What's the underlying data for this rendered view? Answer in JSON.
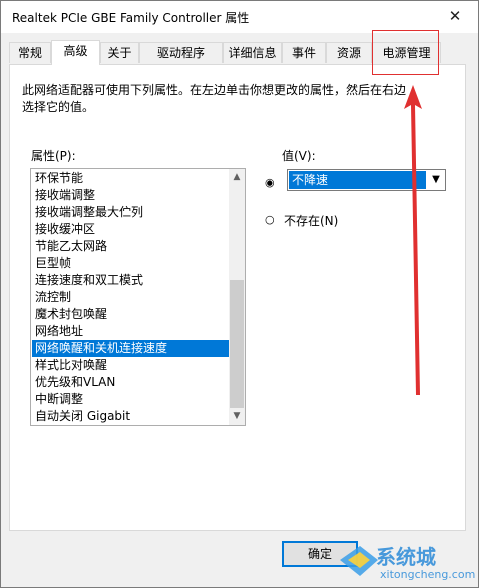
{
  "window": {
    "title": "Realtek PCIe GBE Family Controller 属性",
    "close": "✕"
  },
  "tabs": [
    "常规",
    "高级",
    "关于",
    "驱动程序",
    "详细信息",
    "事件",
    "资源",
    "电源管理"
  ],
  "description": "此网络适配器可使用下列属性。在左边单击你想更改的属性，然后在右边选择它的值。",
  "property_label": "属性(P):",
  "properties": [
    "环保节能",
    "接收端调整",
    "接收端调整最大伫列",
    "接收缓冲区",
    "节能乙太网路",
    "巨型帧",
    "连接速度和双工模式",
    "流控制",
    "魔术封包唤醒",
    "网络地址",
    "网络唤醒和关机连接速度",
    "样式比对唤醒",
    "优先级和VLAN",
    "中断调整",
    "自动关闭 Gigabit"
  ],
  "selected_property": "网络唤醒和关机连接速度",
  "value_label": "值(V):",
  "value_selected": "不降速",
  "radio_absent": "不存在(N)",
  "ok_button": "确定",
  "watermark": {
    "text": "系统城",
    "url": "xitongcheng.com"
  },
  "colors": {
    "accent": "#0078d7",
    "annotation": "#e03030"
  }
}
